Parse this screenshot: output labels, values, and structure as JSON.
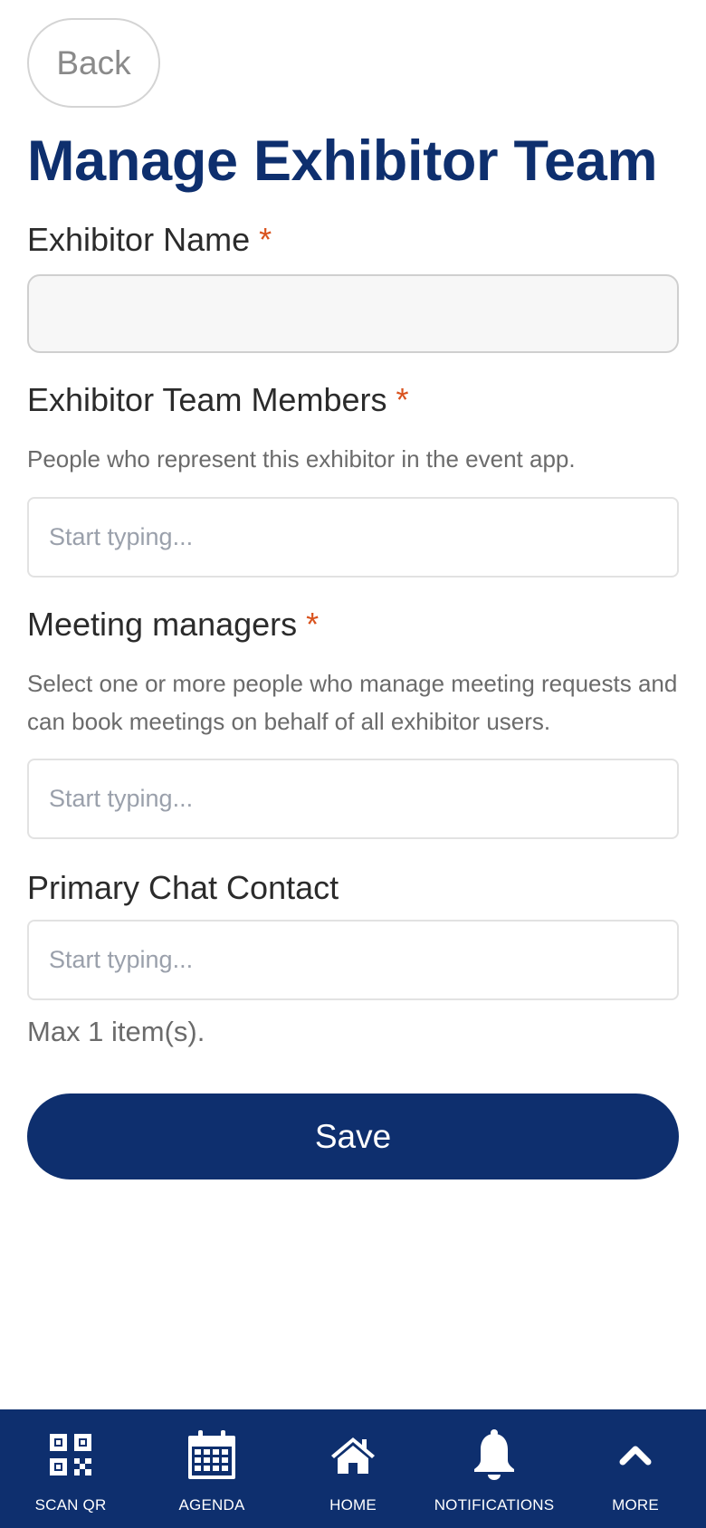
{
  "header": {
    "back_label": "Back",
    "title": "Manage Exhibitor Team"
  },
  "form": {
    "exhibitor_name": {
      "label": "Exhibitor Name",
      "required_mark": "*",
      "value": "",
      "placeholder": ""
    },
    "team_members": {
      "label": "Exhibitor Team Members",
      "required_mark": "*",
      "help": "People who represent this exhibitor in the event app.",
      "value": "",
      "placeholder": "Start typing..."
    },
    "meeting_managers": {
      "label": "Meeting managers",
      "required_mark": "*",
      "help": "Select one or more people who manage meeting requests and can book meetings on behalf of all exhibitor users.",
      "value": "",
      "placeholder": "Start typing..."
    },
    "primary_chat_contact": {
      "label": "Primary Chat Contact",
      "value": "",
      "placeholder": "Start typing...",
      "note": "Max 1 item(s)."
    },
    "save_label": "Save"
  },
  "bottom_nav": {
    "items": [
      {
        "label": "SCAN QR",
        "icon": "qr-code-icon"
      },
      {
        "label": "AGENDA",
        "icon": "calendar-icon"
      },
      {
        "label": "HOME",
        "icon": "home-icon"
      },
      {
        "label": "NOTIFICATIONS",
        "icon": "bell-icon"
      },
      {
        "label": "MORE",
        "icon": "chevron-up-icon"
      }
    ]
  },
  "colors": {
    "brand": "#0e2f6e",
    "required": "#d9531e",
    "muted_text": "#6b6b6b"
  }
}
